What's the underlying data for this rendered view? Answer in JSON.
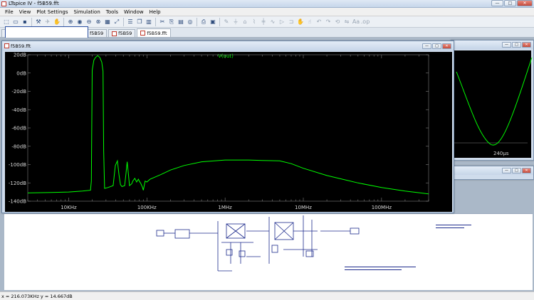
{
  "window": {
    "title": "LTspice IV - f5B59.fft",
    "buttons": {
      "minimize": "—",
      "maximize": "□",
      "close": "✕"
    }
  },
  "menu": [
    "File",
    "View",
    "Plot Settings",
    "Simulation",
    "Tools",
    "Window",
    "Help"
  ],
  "toolbar": [
    "new-schematic-icon",
    "open-icon",
    "save-icon",
    "control-panel-icon",
    "run-icon",
    "halt-icon",
    "zoom-in-icon",
    "zoom-pan-icon",
    "zoom-out-icon",
    "zoom-cancel-icon",
    "autorange-icon",
    "zoom-full-icon",
    "tile-horizontal-icon",
    "cascade-icon",
    "tile-vertical-icon",
    "cut-icon",
    "copy-icon",
    "paste-icon",
    "find-icon",
    "print-icon",
    "print-preview-icon",
    "wire-icon",
    "ground-icon",
    "label-icon",
    "resistor-icon",
    "capacitor-icon",
    "inductor-icon",
    "diode-icon",
    "component-icon",
    "rotate-icon",
    "mirror-icon",
    "undo-icon",
    "redo-icon",
    "text-icon",
    "spice-directive-icon"
  ],
  "tabs": [
    {
      "label": "f5B59",
      "kind": "schematic"
    },
    {
      "label": "f5B59",
      "kind": "waveform"
    },
    {
      "label": "f5B59.fft",
      "kind": "waveform",
      "active": true
    }
  ],
  "fft_window": {
    "title": "f5B59.fft",
    "buttons": {
      "minimize": "—",
      "maximize": "□",
      "close": "✕"
    }
  },
  "transient_window": {
    "buttons": {
      "minimize": "—",
      "maximize": "□",
      "close": "✕"
    },
    "x_tick": "240µs"
  },
  "schematic_window": {
    "buttons": {
      "minimize": "—",
      "maximize": "□",
      "close": "✕"
    }
  },
  "status": "x = 216.073KHz   y = 14.667dB",
  "colors": {
    "trace": "#00ff00",
    "grid": "#808080",
    "background": "#000000"
  },
  "chart_data": {
    "type": "line",
    "title": "",
    "trace_label": "V(out)",
    "x_scale": "log",
    "xlim": [
      3000,
      400000000
    ],
    "ylim": [
      -140,
      20
    ],
    "x_ticks": [
      {
        "value": 10000,
        "label": "10KHz"
      },
      {
        "value": 100000,
        "label": "100KHz"
      },
      {
        "value": 1000000,
        "label": "1MHz"
      },
      {
        "value": 10000000,
        "label": "10MHz"
      },
      {
        "value": 100000000,
        "label": "100MHz"
      }
    ],
    "y_ticks": [
      {
        "value": 20,
        "label": "20dB"
      },
      {
        "value": 0,
        "label": "0dB"
      },
      {
        "value": -20,
        "label": "-20dB"
      },
      {
        "value": -40,
        "label": "-40dB"
      },
      {
        "value": -60,
        "label": "-60dB"
      },
      {
        "value": -80,
        "label": "-80dB"
      },
      {
        "value": -100,
        "label": "-100dB"
      },
      {
        "value": -120,
        "label": "-120dB"
      },
      {
        "value": -140,
        "label": "-140dB"
      }
    ],
    "series": [
      {
        "name": "V(out)",
        "x": [
          3000,
          6000,
          10000,
          15000,
          19000,
          19500,
          20000,
          21000,
          22000,
          23500,
          25000,
          26500,
          27500,
          28000,
          28800,
          32000,
          37000,
          39500,
          42000,
          44000,
          46000,
          48000,
          52000,
          54000,
          56000,
          58000,
          60000,
          64000,
          66000,
          70000,
          74000,
          78000,
          80000,
          84000,
          88000,
          90000,
          95000,
          100000,
          110000,
          150000,
          200000,
          300000,
          500000,
          1000000,
          2000000,
          3000000,
          5000000,
          7000000,
          10000000,
          20000000,
          50000000,
          100000000,
          200000000,
          400000000
        ],
        "y": [
          -131,
          -130.5,
          -130,
          -129,
          -128,
          -118,
          3,
          14,
          17,
          19,
          17,
          12,
          2,
          -85,
          -126,
          -125,
          -123,
          -101,
          -96,
          -111,
          -122,
          -124,
          -123,
          -110,
          -97,
          -110,
          -123,
          -121,
          -118,
          -115,
          -119,
          -116,
          -118,
          -121,
          -125,
          -128,
          -118,
          -119,
          -116,
          -111,
          -106,
          -101,
          -97,
          -95,
          -95,
          -95.5,
          -96,
          -99,
          -104,
          -112,
          -120,
          -125,
          -129,
          -132
        ]
      }
    ]
  }
}
